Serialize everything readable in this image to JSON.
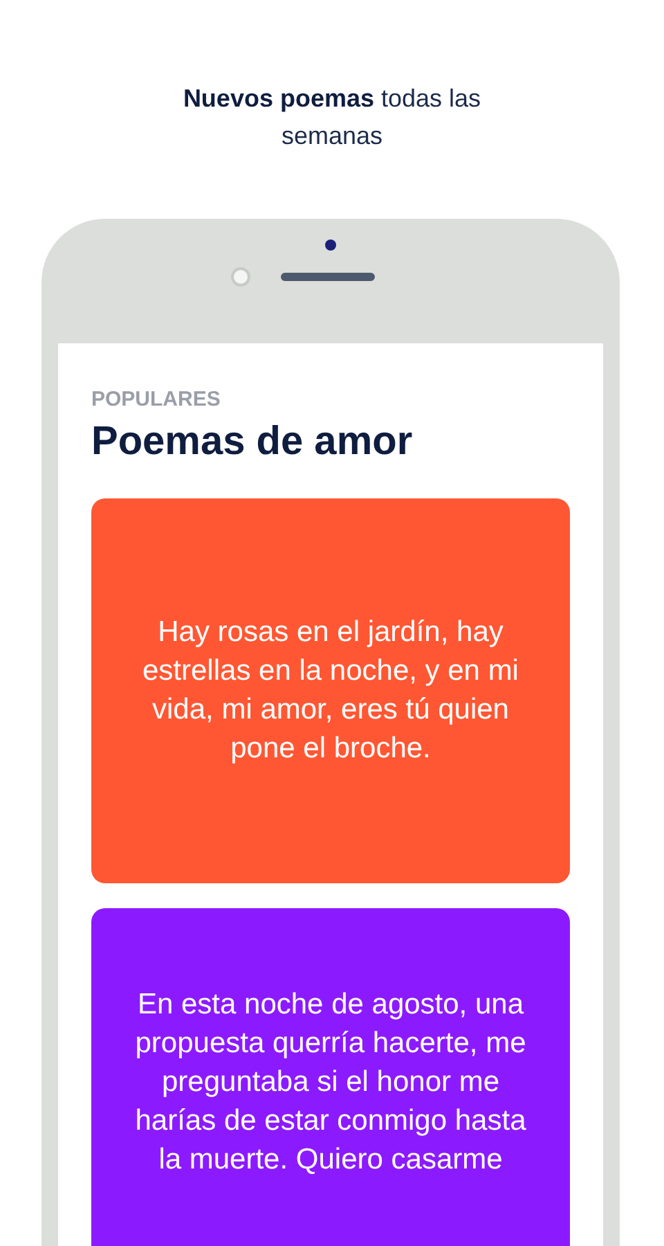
{
  "headline": "**Nuevos poemas** todas las semanas",
  "screen": {
    "section_label": "POPULARES",
    "title": "Poemas de amor",
    "poems": [
      {
        "text": "Hay rosas en el jardín, hay estrellas en la noche, y en mi vida, mi amor, eres tú quien pone el broche.",
        "color": "#ff5733"
      },
      {
        "text": "En esta noche de agosto, una propuesta querría hacerte, me preguntaba si el honor me harías de estar conmigo hasta la muerte. Quiero casarme",
        "color": "#8c1aff"
      }
    ]
  }
}
